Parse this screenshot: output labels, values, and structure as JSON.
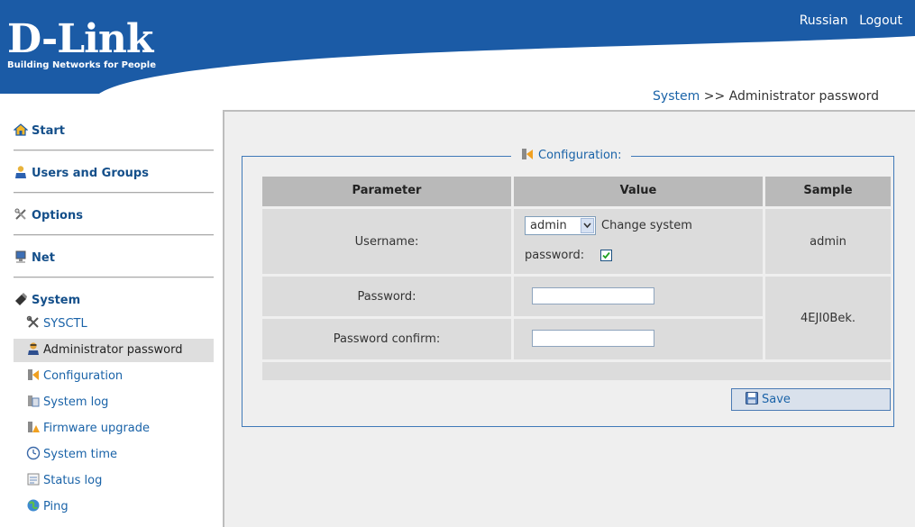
{
  "header": {
    "logo_brand": "D-Link",
    "logo_tagline": "Building Networks for People",
    "nav": {
      "russian": "Russian",
      "logout": "Logout"
    }
  },
  "breadcrumb": {
    "section": "System",
    "separator": ">>",
    "page": "Administrator password"
  },
  "sidebar": {
    "sections": [
      {
        "label": "Start",
        "icon": "home-icon"
      },
      {
        "label": "Users and Groups",
        "icon": "users-icon"
      },
      {
        "label": "Options",
        "icon": "options-icon"
      },
      {
        "label": "Net",
        "icon": "net-icon"
      },
      {
        "label": "System",
        "icon": "system-icon"
      }
    ],
    "system_items": [
      {
        "label": "SYSCTL",
        "icon": "tools-icon"
      },
      {
        "label": "Administrator password",
        "icon": "admin-icon"
      },
      {
        "label": "Configuration",
        "icon": "configuration-icon"
      },
      {
        "label": "System log",
        "icon": "system-log-icon"
      },
      {
        "label": "Firmware upgrade",
        "icon": "firmware-icon"
      },
      {
        "label": "System time",
        "icon": "clock-icon"
      },
      {
        "label": "Status log",
        "icon": "status-log-icon"
      },
      {
        "label": "Ping",
        "icon": "ping-icon"
      }
    ]
  },
  "config": {
    "legend": "Configuration:",
    "columns": {
      "parameter": "Parameter",
      "value": "Value",
      "sample": "Sample"
    },
    "rows": {
      "username": {
        "label": "Username:",
        "selected": "admin",
        "change_label_1": "Change system",
        "change_label_2": "password:",
        "change_checked": true,
        "sample": "admin"
      },
      "password": {
        "label": "Password:",
        "value": ""
      },
      "password_confirm": {
        "label": "Password confirm:",
        "value": ""
      },
      "password_sample": "4EJI0Bek."
    },
    "save_label": "Save"
  },
  "colors": {
    "header_blue": "#1b5ba6",
    "link_blue": "#1a63a8",
    "table_header": "#b9b9b9",
    "table_cell": "#dcdcdc",
    "content_bg": "#efefef"
  }
}
